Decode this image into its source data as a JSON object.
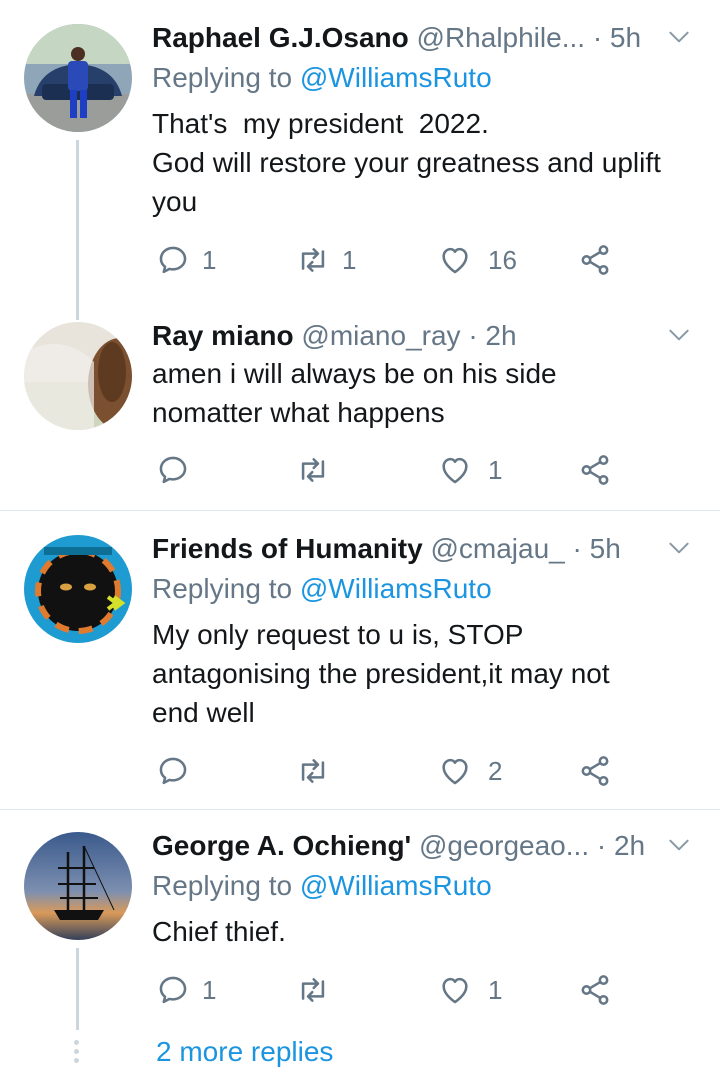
{
  "tweets": [
    {
      "name": "Raphael G.J.Osano",
      "handle": "@Rhalphile...",
      "time": "· 5h",
      "replying_prefix": "Replying to ",
      "replying_to": "@WilliamsRuto",
      "text_lines": [
        "That's  my president  2022.",
        "God will restore your greatness and uplift",
        "you"
      ],
      "replies": "1",
      "retweets": "1",
      "likes": "16"
    },
    {
      "name": "Ray miano",
      "handle": "@miano_ray",
      "time": "· 2h",
      "text_lines": [
        "amen i will always be on his side",
        "nomatter what happens"
      ],
      "replies": "",
      "retweets": "",
      "likes": "1"
    },
    {
      "name": "Friends of Humanity",
      "handle": "@cmajau_",
      "time": "· 5h",
      "replying_prefix": "Replying to ",
      "replying_to": "@WilliamsRuto",
      "text_lines": [
        "My only request to u is, STOP",
        "antagonising the president,it may not",
        "end well"
      ],
      "replies": "",
      "retweets": "",
      "likes": "2"
    },
    {
      "name": "George A. Ochieng'",
      "handle": "@georgeao...",
      "time": "· 2h",
      "replying_prefix": "Replying to ",
      "replying_to": "@WilliamsRuto",
      "text_lines": [
        "Chief thief."
      ],
      "replies": "1",
      "retweets": "",
      "likes": "1"
    }
  ],
  "more_replies": "2 more replies",
  "colors": {
    "text": "#14171a",
    "muted": "#657786",
    "link": "#1b95e0",
    "divider": "#e1e8ed",
    "thread": "#ccd6dd"
  },
  "icons": [
    "reply-icon",
    "retweet-icon",
    "like-icon",
    "share-icon",
    "chevron-down-icon"
  ]
}
